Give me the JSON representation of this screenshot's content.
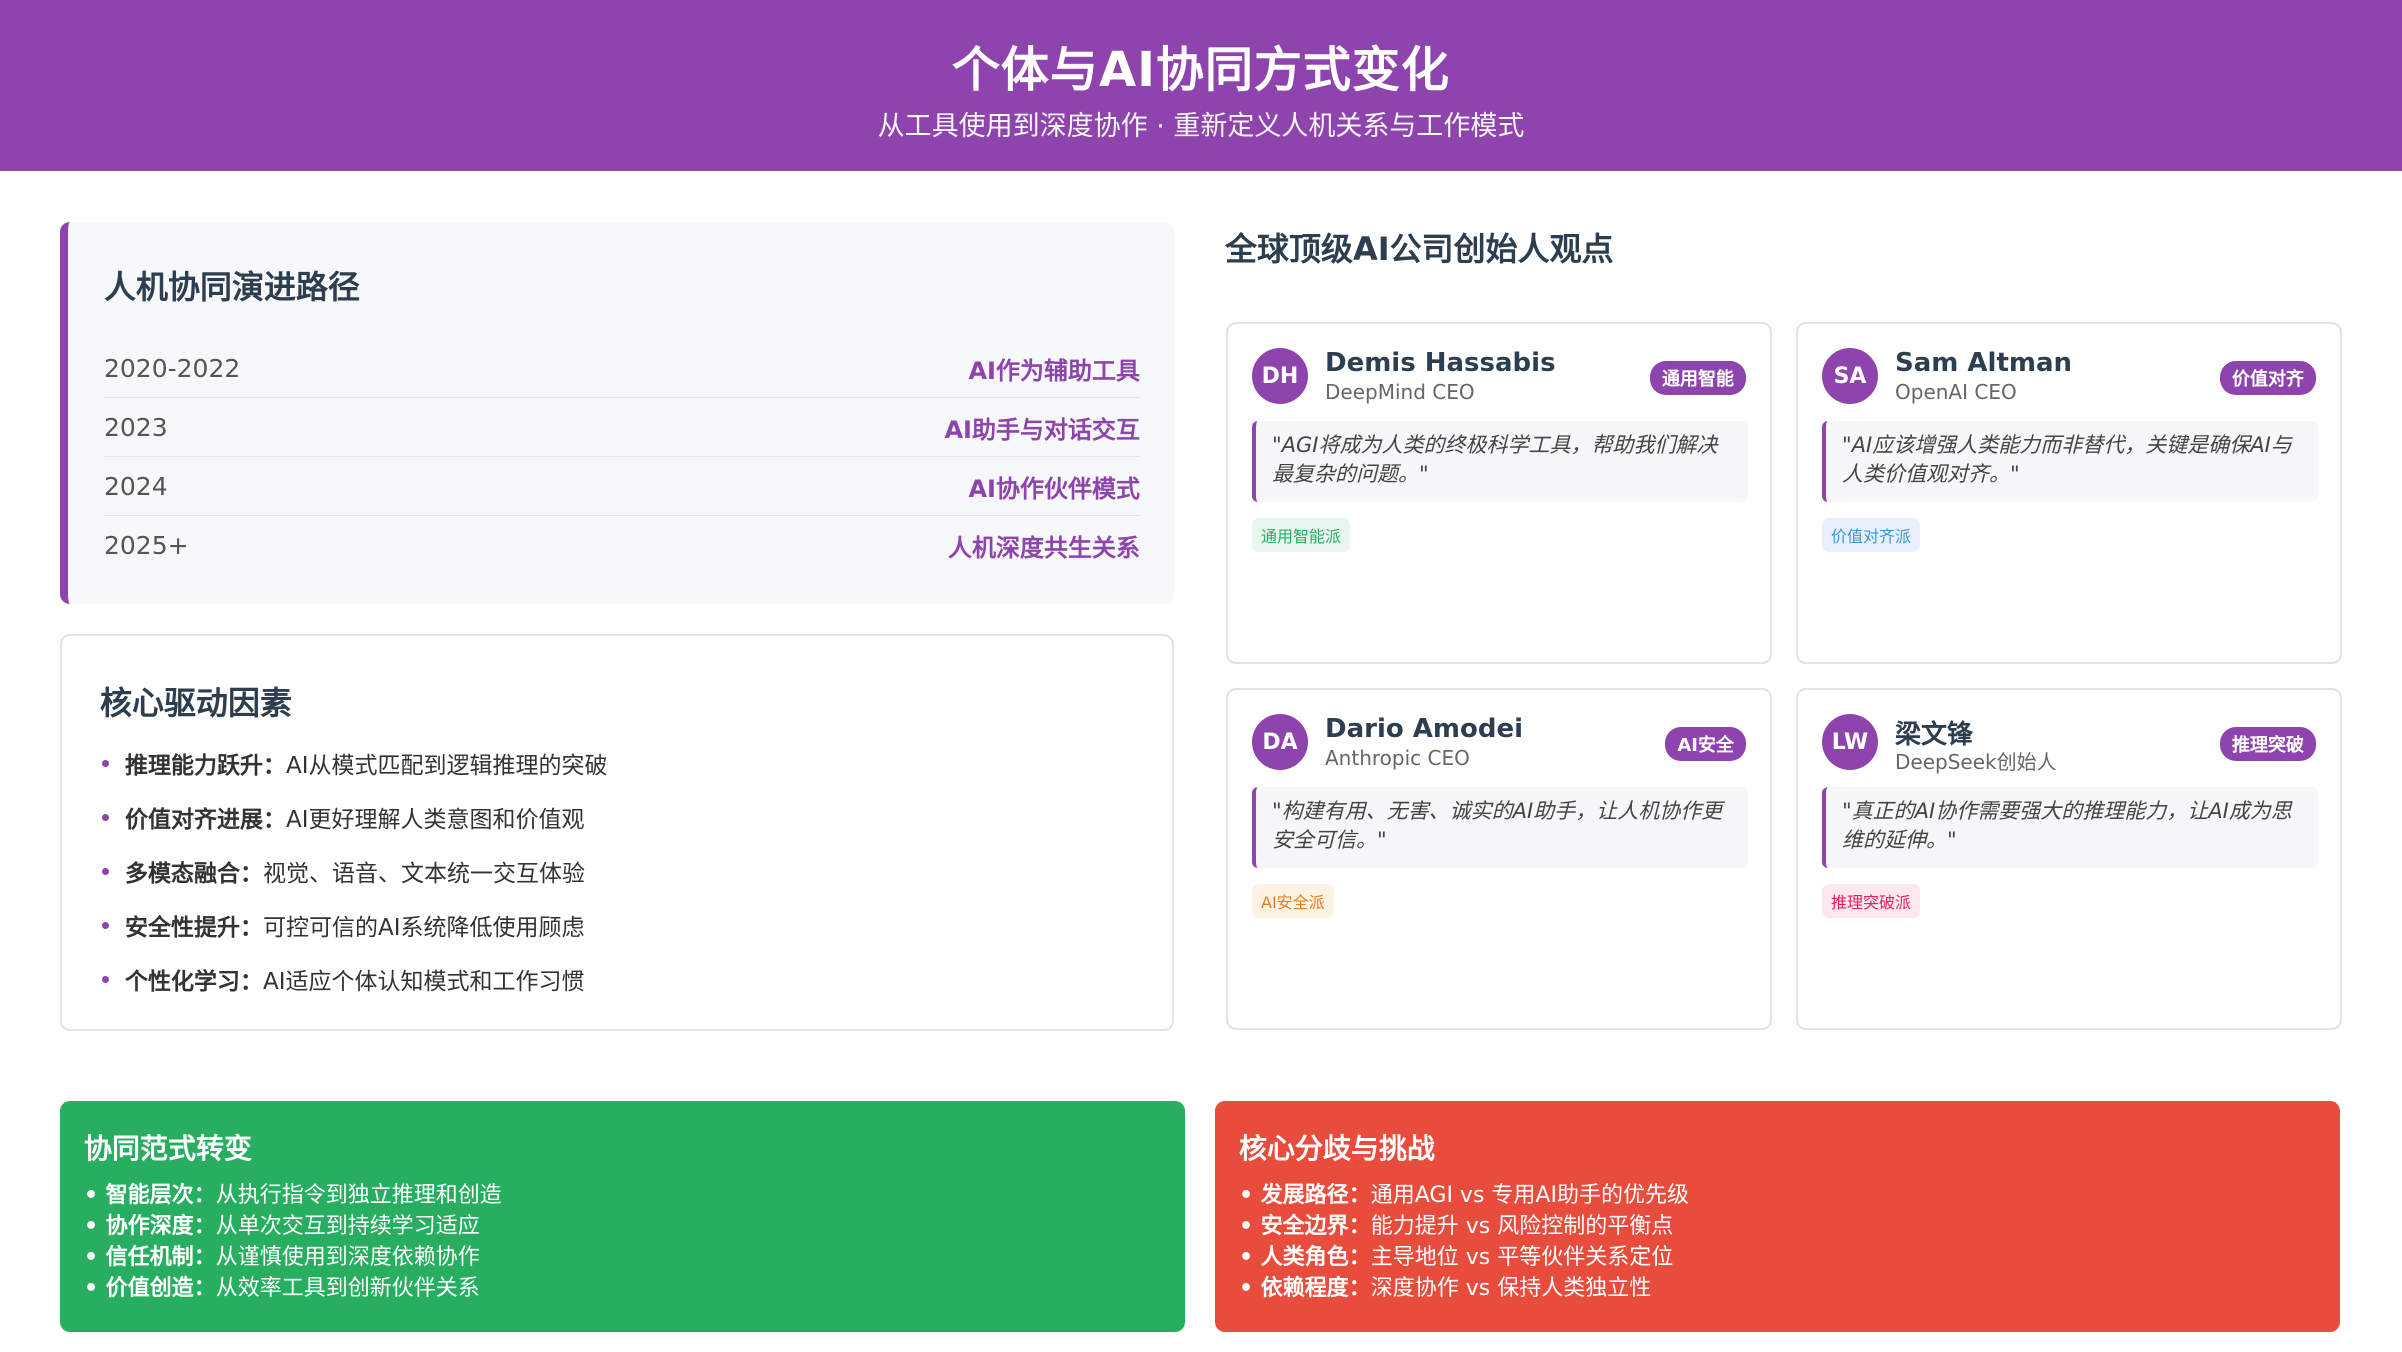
{
  "header": {
    "title": "个体与AI协同方式变化",
    "subtitle": "从工具使用到深度协作 · 重新定义人机关系与工作模式"
  },
  "timeline": {
    "title": "人机协同演进路径",
    "rows": [
      {
        "year": "2020-2022",
        "label": "AI作为辅助工具"
      },
      {
        "year": "2023",
        "label": "AI助手与对话交互"
      },
      {
        "year": "2024",
        "label": "AI协作伙伴模式"
      },
      {
        "year": "2025+",
        "label": "人机深度共生关系"
      }
    ]
  },
  "drivers": {
    "title": "核心驱动因素",
    "items": [
      {
        "key": "推理能力跃升：",
        "text": "AI从模式匹配到逻辑推理的突破"
      },
      {
        "key": "价值对齐进展：",
        "text": "AI更好理解人类意图和价值观"
      },
      {
        "key": "多模态融合：",
        "text": "视觉、语音、文本统一交互体验"
      },
      {
        "key": "安全性提升：",
        "text": "可控可信的AI系统降低使用顾虑"
      },
      {
        "key": "个性化学习：",
        "text": "AI适应个体认知模式和工作习惯"
      }
    ]
  },
  "founders": {
    "title": "全球顶级AI公司创始人观点",
    "cards": [
      {
        "initials": "DH",
        "name": "Demis Hassabis",
        "role": "DeepMind CEO",
        "badge": "通用智能",
        "quote": "\"AGI将成为人类的终极科学工具，帮助我们解决最复杂的问题。\"",
        "tag": "通用智能派",
        "tag_color": "#27ae60"
      },
      {
        "initials": "SA",
        "name": "Sam Altman",
        "role": "OpenAI CEO",
        "badge": "价值对齐",
        "quote": "\"AI应该增强人类能力而非替代，关键是确保AI与人类价值观对齐。\"",
        "tag": "价值对齐派",
        "tag_color": "#3498db"
      },
      {
        "initials": "DA",
        "name": "Dario Amodei",
        "role": "Anthropic CEO",
        "badge": "AI安全",
        "quote": "\"构建有用、无害、诚实的AI助手，让人机协作更安全可信。\"",
        "tag": "AI安全派",
        "tag_color": "#e67e22"
      },
      {
        "initials": "LW",
        "name": "梁文锋",
        "role": "DeepSeek创始人",
        "badge": "推理突破",
        "quote": "\"真正的AI协作需要强大的推理能力，让AI成为思维的延伸。\"",
        "tag": "推理突破派",
        "tag_color": "#e91e63"
      }
    ]
  },
  "paradigm": {
    "title": "协同范式转变",
    "items": [
      {
        "key": "• 智能层次：",
        "text": "从执行指令到独立推理和创造"
      },
      {
        "key": "• 协作深度：",
        "text": "从单次交互到持续学习适应"
      },
      {
        "key": "• 信任机制：",
        "text": "从谨慎使用到深度依赖协作"
      },
      {
        "key": "• 价值创造：",
        "text": "从效率工具到创新伙伴关系"
      }
    ]
  },
  "challenges": {
    "title": "核心分歧与挑战",
    "items": [
      {
        "key": "• 发展路径：",
        "text": "通用AGI vs 专用AI助手的优先级"
      },
      {
        "key": "• 安全边界：",
        "text": "能力提升 vs 风险控制的平衡点"
      },
      {
        "key": "• 人类角色：",
        "text": "主导地位 vs 平等伙伴关系定位"
      },
      {
        "key": "• 依赖程度：",
        "text": "深度协作 vs 保持人类独立性"
      }
    ]
  },
  "colors": {
    "accent": "#8e44ad",
    "green_panel": "#27ae60",
    "red_panel": "#e74c3c"
  }
}
